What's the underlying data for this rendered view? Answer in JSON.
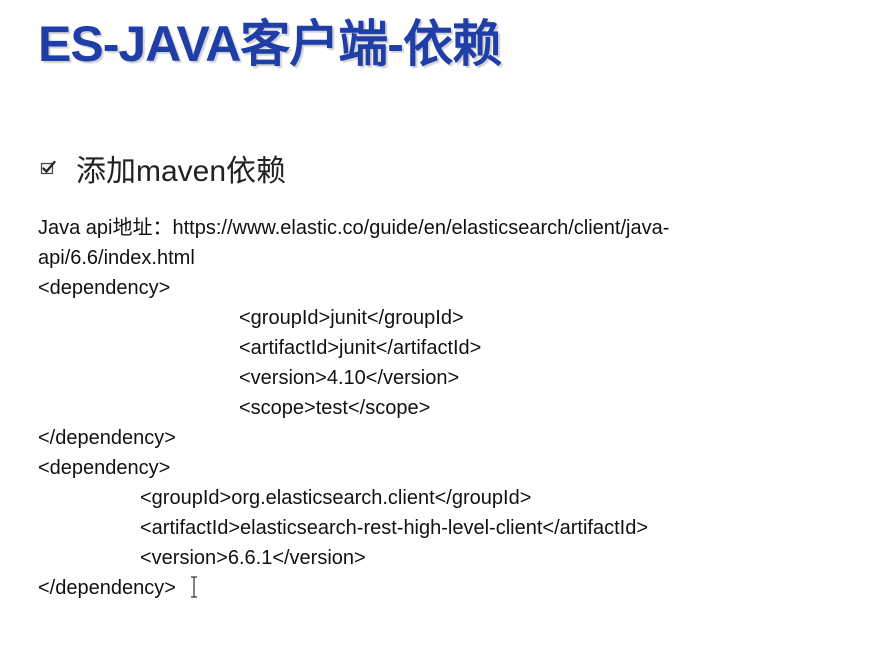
{
  "slide": {
    "title": "ES-JAVA客户端-依赖",
    "bullet": "添加maven依赖",
    "lines": [
      "Java api地址：https://www.elastic.co/guide/en/elasticsearch/client/java-",
      "api/6.6/index.html",
      "<dependency>",
      "<groupId>junit</groupId>",
      "<artifactId>junit</artifactId>",
      "<version>4.10</version>",
      "<scope>test</scope>",
      "</dependency>",
      "<dependency>",
      "<groupId>org.elasticsearch.client</groupId>",
      "<artifactId>elasticsearch-rest-high-level-client</artifactId>",
      "<version>6.6.1</version>",
      "</dependency>"
    ]
  },
  "colors": {
    "title": "#1f3ea8",
    "text": "#111111",
    "background": "#ffffff"
  },
  "icons": {
    "bullet": "checkbox-checked-icon",
    "cursor": "text-cursor-icon"
  }
}
